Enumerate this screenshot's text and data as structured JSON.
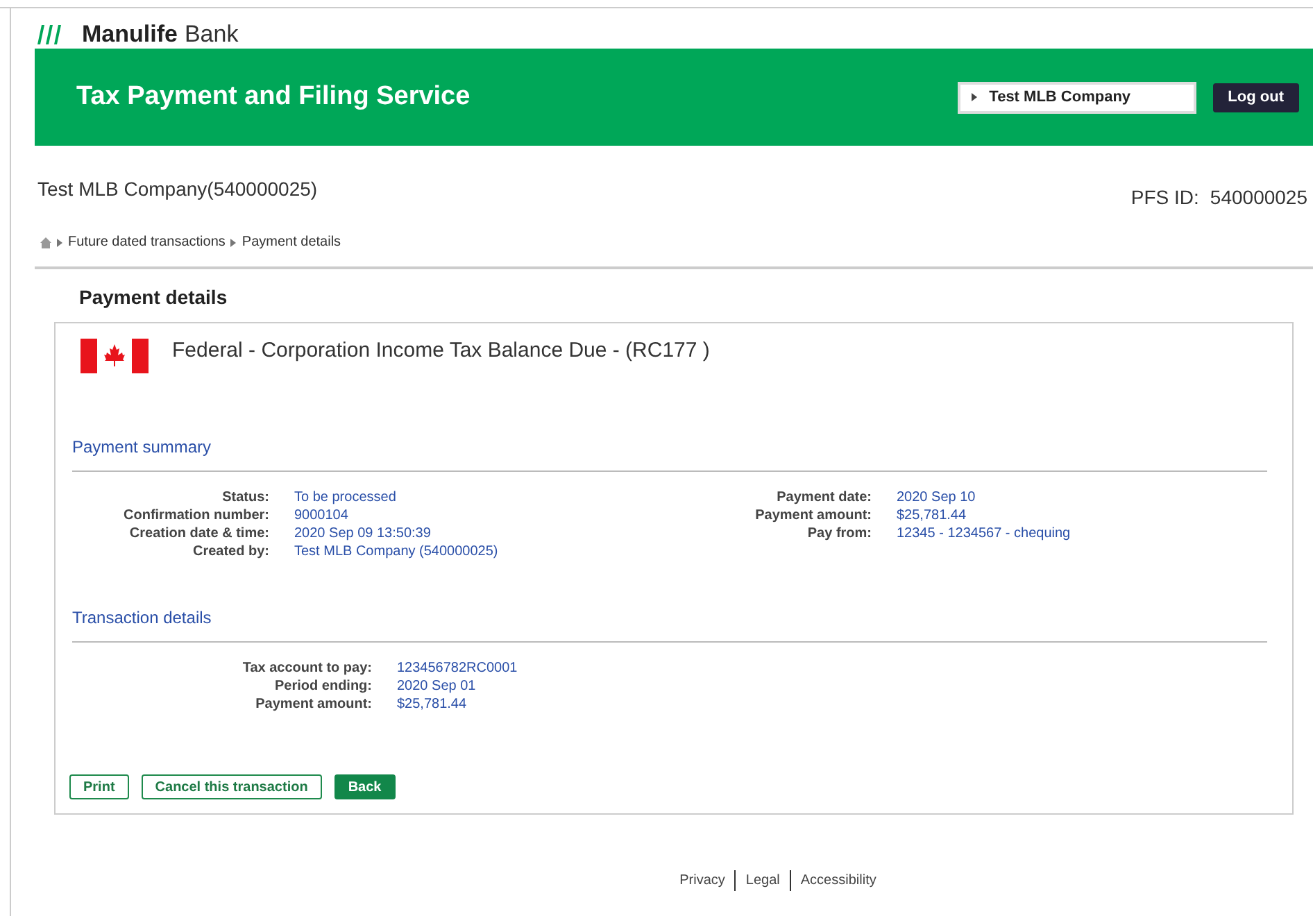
{
  "logo": {
    "brand": "Manulife",
    "suffix": "Bank"
  },
  "banner": {
    "title": "Tax Payment and Filing Service",
    "company_selector": "Test MLB Company",
    "logout": "Log out"
  },
  "company": {
    "name": "Test MLB Company(540000025)",
    "pfs_label": "PFS ID:",
    "pfs_value": "540000025"
  },
  "breadcrumb": [
    "Future dated transactions",
    "Payment details"
  ],
  "page_title": "Payment details",
  "card": {
    "title": "Federal - Corporation Income Tax Balance Due - (RC177 )",
    "summary": {
      "heading": "Payment summary",
      "left": [
        {
          "label": "Status:",
          "value": "To be processed"
        },
        {
          "label": "Confirmation number:",
          "value": "9000104"
        },
        {
          "label": "Creation date & time:",
          "value": "2020 Sep 09 13:50:39"
        },
        {
          "label": "Created by:",
          "value": "Test MLB Company (540000025)"
        }
      ],
      "right": [
        {
          "label": "Payment date:",
          "value": "2020 Sep 10"
        },
        {
          "label": "Payment amount:",
          "value": "$25,781.44"
        },
        {
          "label": "Pay from:",
          "value": "12345 - 1234567 - chequing"
        }
      ]
    },
    "transaction": {
      "heading": "Transaction details",
      "rows": [
        {
          "label": "Tax account to pay:",
          "value": "123456782RC0001"
        },
        {
          "label": "Period ending:",
          "value": "2020 Sep 01"
        },
        {
          "label": "Payment amount:",
          "value": "$25,781.44"
        }
      ]
    },
    "buttons": [
      {
        "label": "Print",
        "kind": "outline"
      },
      {
        "label": "Cancel this transaction",
        "kind": "outline"
      },
      {
        "label": "Back",
        "kind": "primary"
      }
    ]
  },
  "footer": [
    "Privacy",
    "Legal",
    "Accessibility"
  ]
}
